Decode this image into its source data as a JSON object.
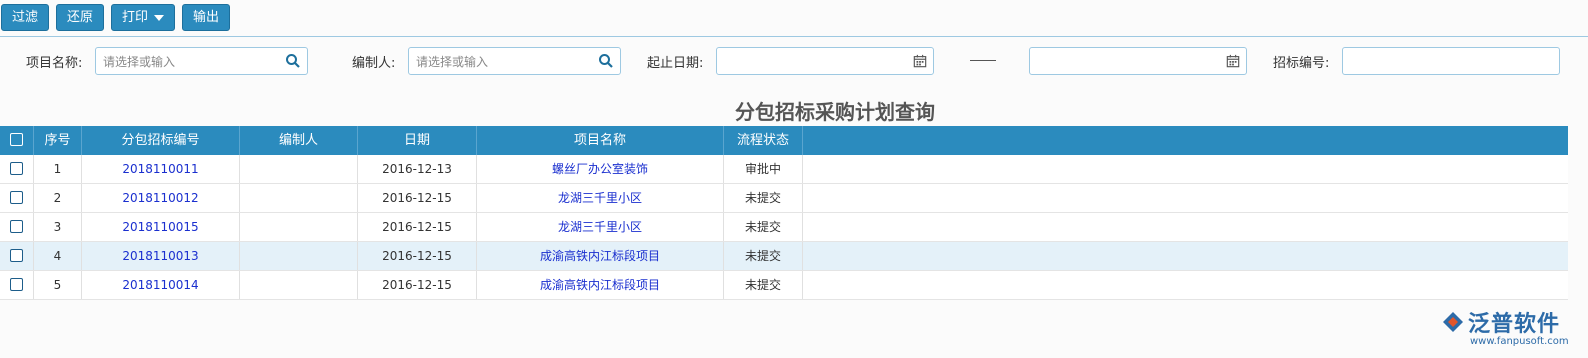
{
  "toolbar": {
    "filter_label": "过滤",
    "restore_label": "还原",
    "print_label": "打印",
    "export_label": "输出"
  },
  "filters": {
    "project_name_label": "项目名称:",
    "project_name_placeholder": "请选择或输入",
    "editor_label": "编制人:",
    "editor_placeholder": "请选择或输入",
    "date_range_label": "起止日期:",
    "bid_no_label": "招标编号:"
  },
  "page_title": "分包招标采购计划查询",
  "table": {
    "headers": [
      "序号",
      "分包招标编号",
      "编制人",
      "日期",
      "项目名称",
      "流程状态"
    ],
    "rows": [
      {
        "seq": "1",
        "bid_no": "2018110011",
        "editor": "",
        "date": "2016-12-13",
        "project": "螺丝厂办公室装饰",
        "status": "审批中"
      },
      {
        "seq": "2",
        "bid_no": "2018110012",
        "editor": "",
        "date": "2016-12-15",
        "project": "龙湖三千里小区",
        "status": "未提交"
      },
      {
        "seq": "3",
        "bid_no": "2018110015",
        "editor": "",
        "date": "2016-12-15",
        "project": "龙湖三千里小区",
        "status": "未提交"
      },
      {
        "seq": "4",
        "bid_no": "2018110013",
        "editor": "",
        "date": "2016-12-15",
        "project": "成渝高铁内江标段项目",
        "status": "未提交"
      },
      {
        "seq": "5",
        "bid_no": "2018110014",
        "editor": "",
        "date": "2016-12-15",
        "project": "成渝高铁内江标段项目",
        "status": "未提交"
      }
    ]
  },
  "logo": {
    "brand": "泛普软件",
    "url": "www.fanpusoft.com"
  },
  "colors": {
    "accent": "#2b8bbe",
    "link": "#1a2fcf",
    "highlight_row": "#e4f1f9"
  }
}
